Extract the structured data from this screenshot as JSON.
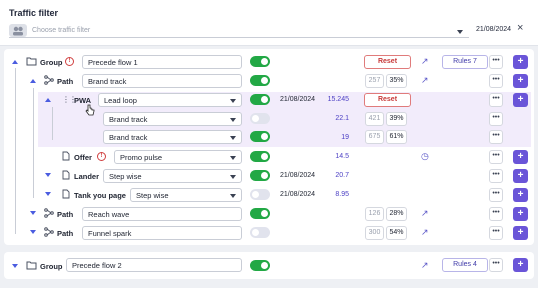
{
  "header": {
    "title": "Traffic filter",
    "placeholder": "Choose traffic filter",
    "date": "21/08/2024",
    "close": "×"
  },
  "rows": [
    {
      "kind": "group",
      "label": "Group",
      "value": "Precede flow 1",
      "reset": "Reset",
      "rules": "Rules 7",
      "toggle": "on"
    },
    {
      "kind": "path",
      "label": "Path",
      "value": "Brand track",
      "count": "257",
      "pct": "35%",
      "toggle": "on"
    },
    {
      "kind": "pwa",
      "label": "PWA",
      "value": "Lead loop",
      "date": "21/08/2024",
      "num": "15.245",
      "reset": "Reset",
      "toggle": "on"
    },
    {
      "kind": "sub",
      "value": "Brand track",
      "num": "22.1",
      "count": "421",
      "pct": "39%",
      "toggle": "off"
    },
    {
      "kind": "sub",
      "value": "Brand track",
      "num": "19",
      "count": "675",
      "pct": "61%",
      "toggle": "on"
    },
    {
      "kind": "offer",
      "label": "Offer",
      "value": "Promo pulse",
      "num": "14.5",
      "toggle": "on"
    },
    {
      "kind": "lander",
      "label": "Lander",
      "value": "Step wise",
      "date": "21/08/2024",
      "num": "20.7",
      "toggle": "on"
    },
    {
      "kind": "typ",
      "label": "Tank you page",
      "value": "Step wise",
      "date": "21/08/2024",
      "num": "8.95",
      "toggle": "off"
    },
    {
      "kind": "path2",
      "label": "Path",
      "value": "Reach wave",
      "count": "126",
      "pct": "28%",
      "toggle": "on"
    },
    {
      "kind": "path3",
      "label": "Path",
      "value": "Funnel spark",
      "count": "300",
      "pct": "54%",
      "toggle": "off"
    },
    {
      "kind": "group2",
      "label": "Group",
      "value": "Precede flow 2",
      "rules": "Rules 4",
      "toggle": "on"
    }
  ],
  "icons": {
    "more": "•••",
    "add": "+",
    "warn": "!",
    "trend": "↗",
    "speed": "◷",
    "drag": "⋮⋮"
  },
  "colors": {
    "accent": "#6a55d8",
    "toggle_on": "#22a845",
    "reset": "#c83a3a",
    "highlight": "#f2ecfb"
  }
}
